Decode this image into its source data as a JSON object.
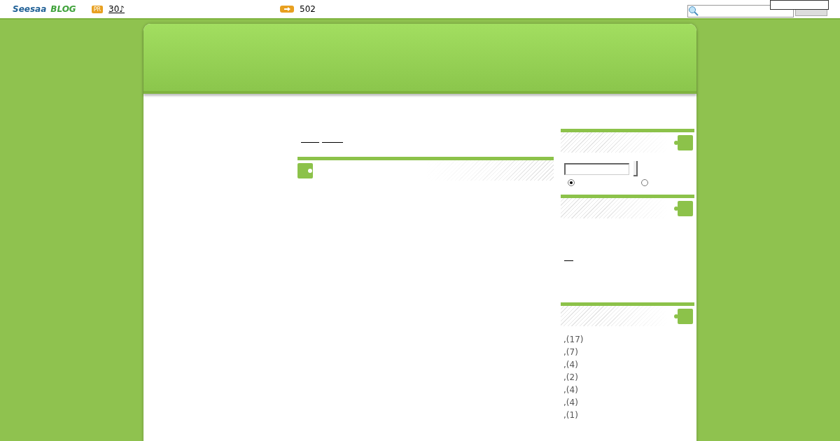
{
  "topbar": {
    "logo": "Seesaa",
    "logo_suffix": "BLOG",
    "pr_badge": "PR",
    "pr_link": "30♪",
    "count": "502"
  },
  "search_widget": {
    "options": [
      {
        "selected": true
      },
      {
        "selected": false
      }
    ]
  },
  "categories": [
    {
      "label": ",(17)"
    },
    {
      "label": ",(7)"
    },
    {
      "label": ",(4)"
    },
    {
      "label": ",(2)"
    },
    {
      "label": ",(4)"
    },
    {
      "label": ",(4)"
    },
    {
      "label": ",(1)"
    }
  ]
}
